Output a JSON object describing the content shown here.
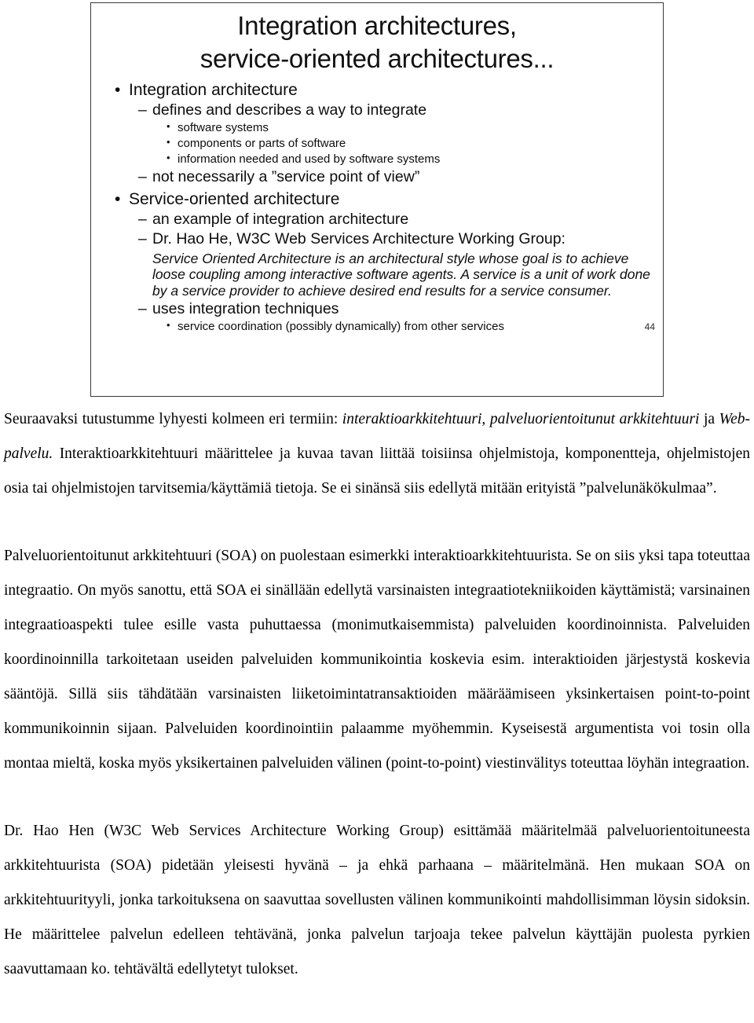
{
  "slide": {
    "title": "Integration architectures,\nservice-oriented architectures...",
    "page_number": "44",
    "bullets": {
      "b1": "Integration architecture",
      "b1_s1": "defines and describes a way to integrate",
      "b1_s1_i1": "software systems",
      "b1_s1_i2": "components or parts of software",
      "b1_s1_i3": "information needed and used by software systems",
      "b1_s2": "not necessarily a ”service point of view”",
      "b2": "Service-oriented architecture",
      "b2_s1": "an example of integration architecture",
      "b2_s2": "Dr. Hao He, W3C Web Services Architecture Working Group:",
      "b2_quote": "Service Oriented Architecture is an architectural style whose goal is to achieve loose coupling among interactive software agents. A service is a unit of work done by a service provider to achieve desired end results for a service consumer.",
      "b2_s3": "uses integration techniques",
      "b2_s3_i1": "service coordination (possibly dynamically) from other services"
    },
    "markers": {
      "bullet_dot": "•",
      "dash": "–"
    }
  },
  "document": {
    "para1_a": "Seuraavaksi tutustumme lyhyesti kolmeen eri termiin: ",
    "para1_em1": "interaktioarkkitehtuuri, palveluorientoitunut arkkitehtuuri",
    "para1_b": " ja ",
    "para1_em2": "Web-palvelu.",
    "para1_c": " Interaktioarkkitehtuuri määrittelee ja kuvaa tavan liittää toisiinsa ohjelmistoja, komponentteja, ohjelmistojen osia tai ohjelmistojen tarvitsemia/käyttämiä tietoja. Se ei sinänsä siis edellytä mitään erityistä ”palvelunäkökulmaa”.",
    "para2": "Palveluorientoitunut arkkitehtuuri (SOA) on puolestaan esimerkki interaktioarkkitehtuurista. Se on siis yksi tapa toteuttaa integraatio. On myös sanottu, että SOA ei sinällään edellytä varsinaisten integraatiotekniikoiden käyttämistä; varsinainen integraatioaspekti tulee esille vasta puhuttaessa (monimutkaisemmista) palveluiden koordinoinnista. Palveluiden koordinoinnilla tarkoitetaan useiden palveluiden kommunikointia koskevia esim. interaktioiden järjestystä koskevia sääntöjä. Sillä siis tähdätään varsinaisten liiketoimintatransaktioiden määräämiseen yksinkertaisen point-to-point kommunikoinnin sijaan. Palveluiden koordinointiin palaamme myöhemmin. Kyseisestä argumentista voi tosin olla montaa mieltä, koska myös yksikertainen palveluiden välinen (point-to-point) viestinvälitys toteuttaa löyhän integraation.",
    "para3": "Dr. Hao Hen (W3C Web Services Architecture Working Group) esittämää määritelmää palveluorientoituneesta arkkitehtuurista (SOA) pidetään yleisesti hyvänä – ja ehkä parhaana – määritelmänä. Hen mukaan SOA on arkkitehtuurityyli, jonka tarkoituksena on saavuttaa sovellusten välinen kommunikointi mahdollisimman löysin sidoksin. He määrittelee palvelun edelleen tehtävänä, jonka palvelun tarjoaja tekee palvelun käyttäjän puolesta pyrkien saavuttamaan ko. tehtävältä edellytetyt tulokset."
  }
}
